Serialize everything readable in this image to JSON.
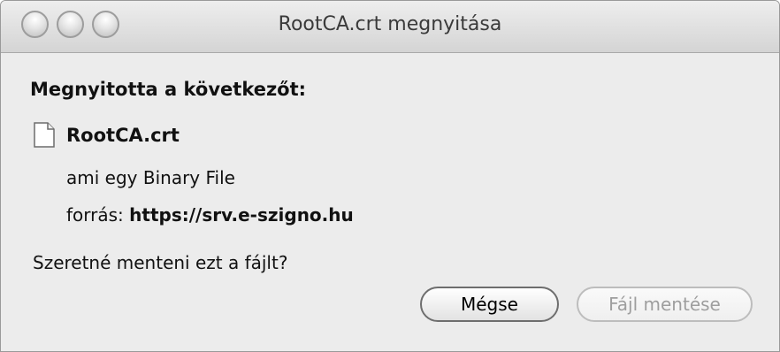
{
  "window": {
    "title": "RootCA.crt megnyitása"
  },
  "dialog": {
    "heading": "Megnyitotta a következőt:",
    "file_name": "RootCA.crt",
    "type_prefix": "ami egy ",
    "type_value": "Binary File",
    "source_prefix": "forrás: ",
    "source_url": "https://srv.e-szigno.hu",
    "question": "Szeretné menteni ezt a fájlt?"
  },
  "buttons": {
    "cancel_label": "Mégse",
    "save_label": "Fájl mentése"
  },
  "icons": {
    "window_controls": [
      "close-button",
      "minimize-button",
      "zoom-button"
    ],
    "file": "document-icon"
  },
  "colors": {
    "window_background": "#ececec",
    "disabled_text": "#9e9e9e"
  }
}
